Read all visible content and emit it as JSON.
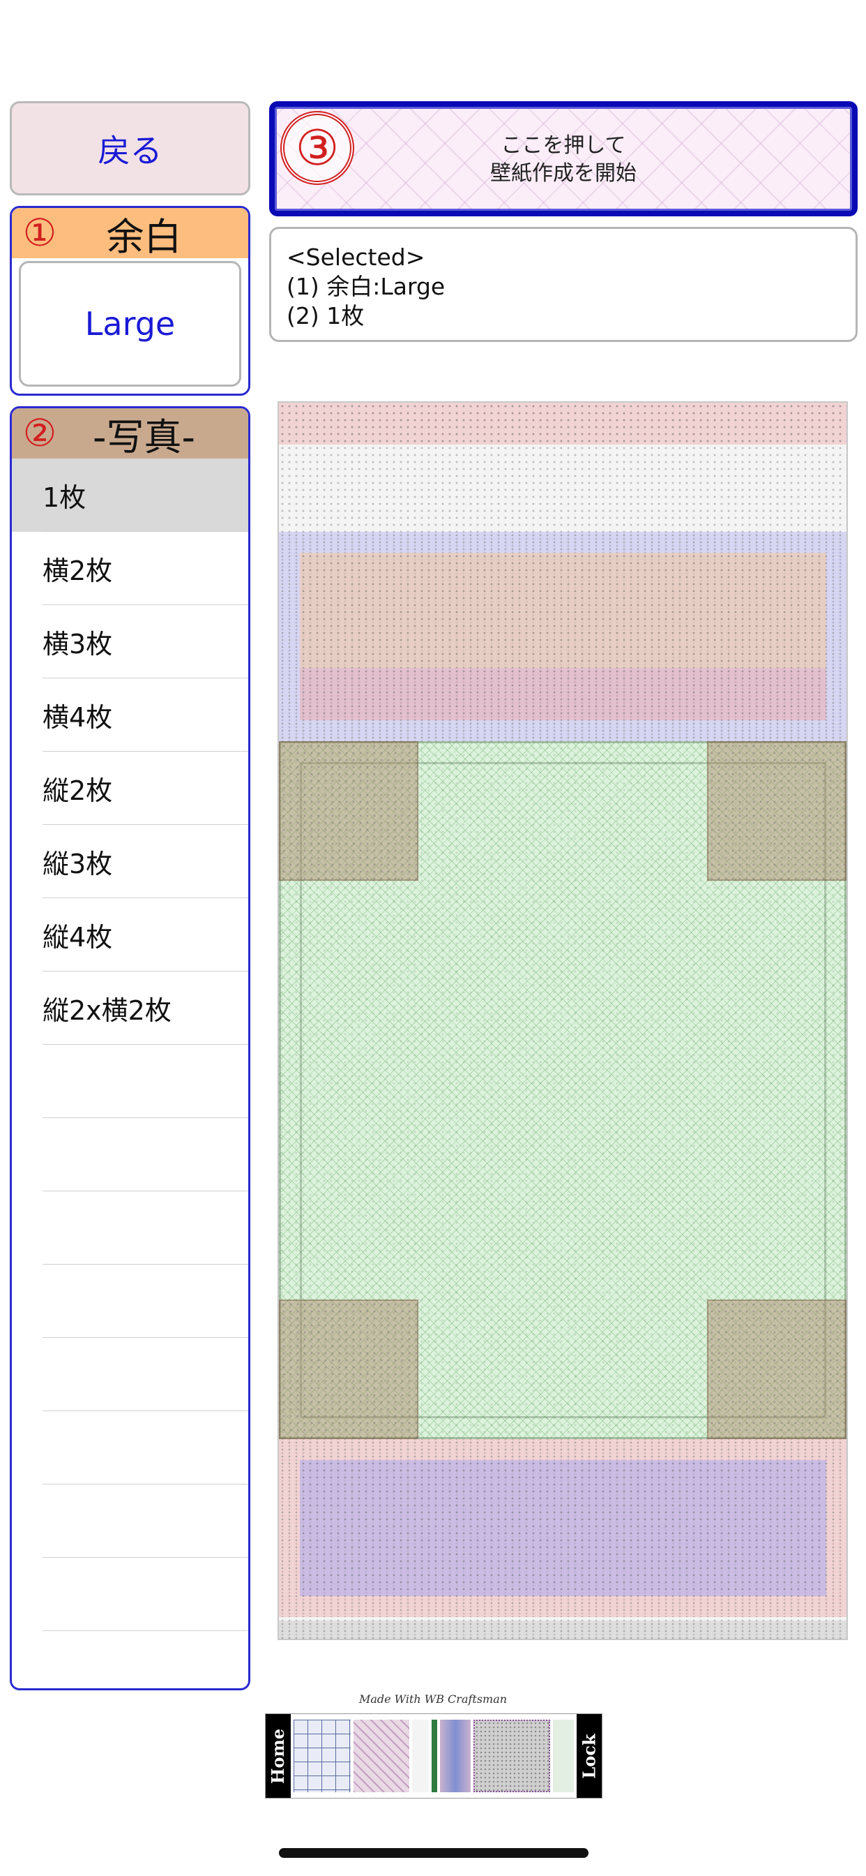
{
  "back_button": {
    "label": "戻る"
  },
  "margin_section": {
    "number": "①",
    "title": "余白",
    "value": "Large"
  },
  "photo_section": {
    "number": "②",
    "title": "-写真-",
    "items": [
      {
        "label": "1枚",
        "selected": true
      },
      {
        "label": "横2枚",
        "selected": false
      },
      {
        "label": "横3枚",
        "selected": false
      },
      {
        "label": "横4枚",
        "selected": false
      },
      {
        "label": "縦2枚",
        "selected": false
      },
      {
        "label": "縦3枚",
        "selected": false
      },
      {
        "label": "縦4枚",
        "selected": false
      },
      {
        "label": "縦2x横2枚",
        "selected": false
      },
      {
        "label": "",
        "selected": false
      },
      {
        "label": "",
        "selected": false
      },
      {
        "label": "",
        "selected": false
      },
      {
        "label": "",
        "selected": false
      },
      {
        "label": "",
        "selected": false
      },
      {
        "label": "",
        "selected": false
      },
      {
        "label": "",
        "selected": false
      },
      {
        "label": "",
        "selected": false
      },
      {
        "label": "",
        "selected": false
      }
    ]
  },
  "start_button": {
    "number": "③",
    "line1": "ここを押して",
    "line2": "壁紙作成を開始"
  },
  "selected_info": {
    "header": "<Selected>",
    "line1": "(1) 余白:Large",
    "line2": "(2) 1枚"
  },
  "thumbnail": {
    "caption": "Made With WB Craftsman",
    "left_label": "Home",
    "right_label": "Lock"
  },
  "colors": {
    "accent_blue": "#1a1ad6",
    "marker_red": "#d21f1f",
    "margin_header": "#fdbd7e",
    "photo_header": "#c9a98e",
    "selected_row": "#d9d9d9"
  }
}
